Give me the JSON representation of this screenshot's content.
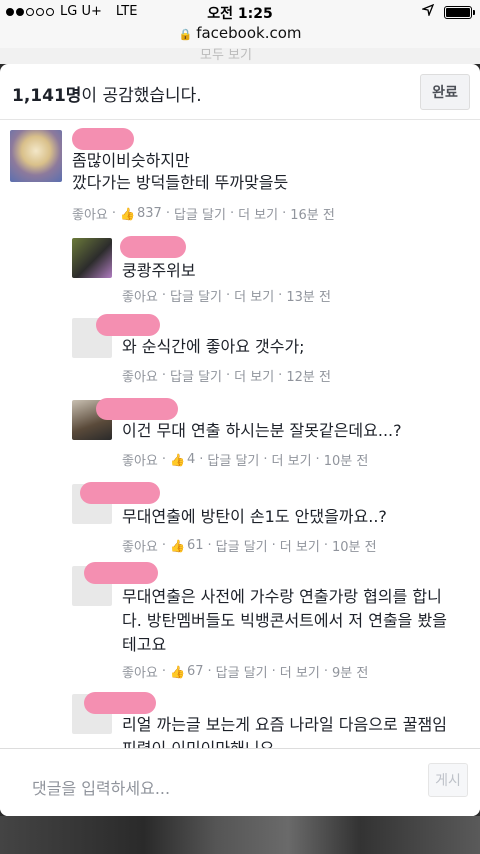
{
  "status_bar": {
    "carrier": "LG U+",
    "network": "LTE",
    "time": "오전 1:25"
  },
  "url_bar": {
    "domain": "facebook.com"
  },
  "background_peek_text": "모두 보기",
  "modal": {
    "reactions_count": "1,141명",
    "reactions_suffix": "이 공감했습니다.",
    "done_label": "완료"
  },
  "comments": [
    {
      "lines": [
        "좀많이비슷하지만",
        "깠다가는 방덕들한테 뚜까맞을듯"
      ],
      "like": "좋아요",
      "count": "837",
      "reply": "답글 달기",
      "more": "더 보기",
      "time": "16분 전"
    },
    {
      "lines": [
        "쿵쾅주위보"
      ],
      "like": "좋아요",
      "count": "",
      "reply": "답글 달기",
      "more": "더 보기",
      "time": "13분 전"
    },
    {
      "lines": [
        "와 순식간에 좋아요 갯수가;"
      ],
      "like": "좋아요",
      "count": "",
      "reply": "답글 달기",
      "more": "더 보기",
      "time": "12분 전"
    },
    {
      "lines": [
        "이건 무대 연출 하시는분 잘못같은데요...?"
      ],
      "like": "좋아요",
      "count": "4",
      "reply": "답글 달기",
      "more": "더 보기",
      "time": "10분 전"
    },
    {
      "lines": [
        "무대연출에 방탄이 손1도 안댔을까요..?"
      ],
      "like": "좋아요",
      "count": "61",
      "reply": "답글 달기",
      "more": "더 보기",
      "time": "10분 전"
    },
    {
      "lines": [
        "무대연출은 사전에 가수랑 연출가랑 협의를 합니",
        "다. 방탄멤버들도 빅뱅콘서트에서 저 연출을 봤을",
        "테고요"
      ],
      "like": "좋아요",
      "count": "67",
      "reply": "답글 달기",
      "more": "더 보기",
      "time": "9분 전"
    },
    {
      "lines": [
        "리얼 까는글 보는게 요즘 나라일 다음으로 꿀잼임",
        "피령이 이미이마해니요"
      ],
      "like": "",
      "count": "",
      "reply": "",
      "more": "",
      "time": ""
    }
  ],
  "input": {
    "placeholder": "댓글을 입력하세요...",
    "send_label": "게시"
  },
  "icons": {
    "lock": "lock-icon",
    "location": "location-arrow-icon",
    "battery": "battery-icon",
    "like": "thumbs-up-icon"
  },
  "colors": {
    "accent": "#4267b2",
    "name_redaction": "#f48fb1",
    "meta": "#90949c"
  }
}
